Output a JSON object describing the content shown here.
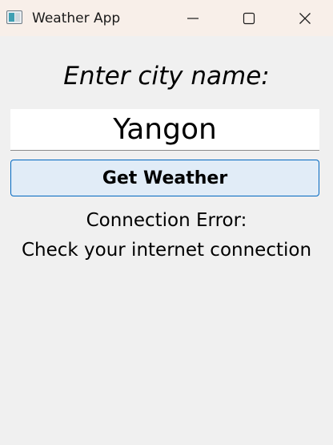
{
  "window": {
    "title": "Weather App",
    "icons": {
      "app": "app-window-icon",
      "minimize": "minimize-icon",
      "maximize": "maximize-icon",
      "close": "close-icon"
    }
  },
  "form": {
    "prompt": "Enter city name:",
    "city_value": "Yangon",
    "button_label": "Get Weather"
  },
  "status": {
    "line1": "Connection Error:",
    "line2": "Check your internet connection"
  },
  "colors": {
    "titlebar": "#f8efe9",
    "background": "#f0f0f0",
    "button_fill": "#e1ecf7",
    "button_border": "#0067c0"
  }
}
